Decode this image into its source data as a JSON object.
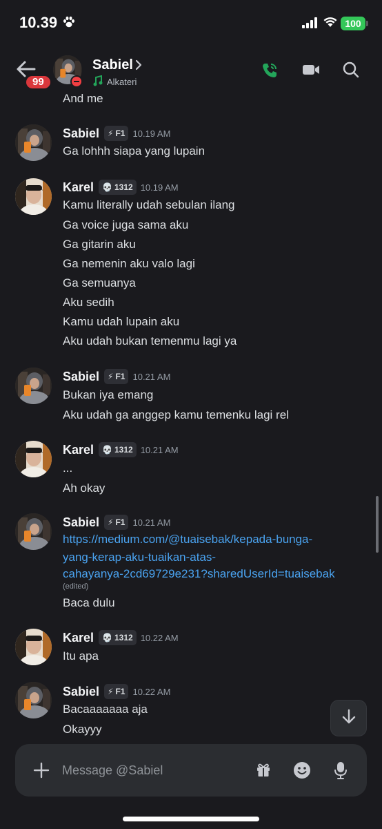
{
  "status_bar": {
    "time": "10.39",
    "battery": "100"
  },
  "header": {
    "unread_count": "99",
    "name": "Sabiel",
    "activity": "Alkateri"
  },
  "tags": {
    "sabiel": {
      "emoji": "⚡",
      "label": "F1"
    },
    "karel": {
      "emoji": "💀",
      "label": "1312"
    }
  },
  "chat": {
    "top_cutoff": "And me",
    "groups": [
      {
        "author": "Sabiel",
        "time": "10.19 AM",
        "lines": [
          "Ga lohhh siapa yang lupain"
        ]
      },
      {
        "author": "Karel",
        "time": "10.19 AM",
        "lines": [
          "Kamu literally udah sebulan ilang",
          "Ga voice juga sama aku",
          "Ga gitarin aku",
          "Ga nemenin aku valo lagi",
          "Ga semuanya",
          "Aku sedih",
          "Kamu udah lupain aku",
          "Aku udah bukan temenmu lagi ya"
        ]
      },
      {
        "author": "Sabiel",
        "time": "10.21 AM",
        "lines": [
          "Bukan iya emang",
          "Aku udah ga anggep kamu temenku lagi rel"
        ]
      },
      {
        "author": "Karel",
        "time": "10.21 AM",
        "lines": [
          "...",
          "Ah okay"
        ]
      },
      {
        "author": "Sabiel",
        "time": "10.21 AM",
        "link_lines": [
          "https://medium.com/@tuaisebak/kepada-bunga-",
          "yang-kerap-aku-tuaikan-atas-",
          "cahayanya-2cd69729e231?sharedUserId=tuaisebak"
        ],
        "edited": "(edited)",
        "lines": [
          "Baca dulu"
        ]
      },
      {
        "author": "Karel",
        "time": "10.22 AM",
        "lines": [
          "Itu apa"
        ]
      },
      {
        "author": "Sabiel",
        "time": "10.22 AM",
        "lines": [
          "Bacaaaaaaa aja",
          "Okayyy"
        ]
      }
    ]
  },
  "composer": {
    "placeholder": "Message @Sabiel"
  },
  "colors": {
    "background": "#1a1a1e",
    "call_green": "#23a55a",
    "link": "#4aa3f0",
    "badge_red": "#da373c",
    "battery_green": "#34c759"
  },
  "icons": [
    "paw-icon",
    "signal-icon",
    "wifi-icon",
    "back-arrow-icon",
    "chevron-right-icon",
    "music-note-icon",
    "voice-call-icon",
    "video-call-icon",
    "search-icon",
    "arrow-down-icon",
    "plus-icon",
    "gift-icon",
    "emoji-icon",
    "microphone-icon"
  ]
}
